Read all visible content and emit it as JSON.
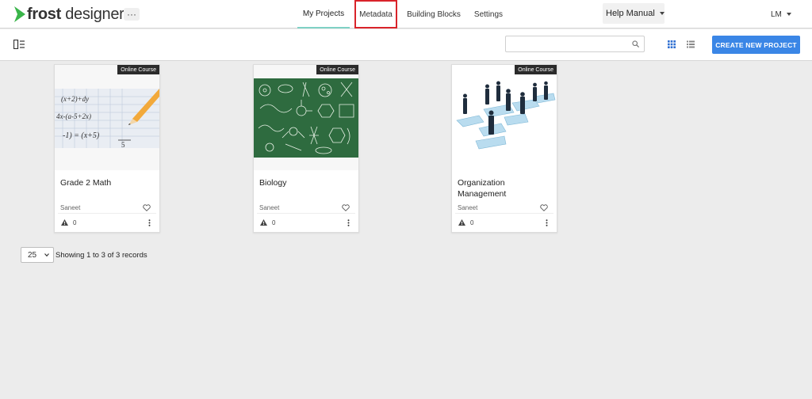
{
  "app": {
    "logo_bold": "frost",
    "logo_light": " designer",
    "more_label": "···"
  },
  "nav": {
    "tabs": [
      {
        "label": "My Projects",
        "active": true
      },
      {
        "label": "Metadata",
        "highlighted": true
      },
      {
        "label": "Building Blocks"
      },
      {
        "label": "Settings"
      }
    ],
    "help_label": "Help Manual",
    "user_initials": "LM"
  },
  "toolbar": {
    "search_placeholder": "",
    "create_label": "CREATE NEW PROJECT",
    "icons": [
      "sidebar-toggle-icon",
      "search-icon",
      "grid-view-icon",
      "list-view-icon"
    ]
  },
  "projects": [
    {
      "title": "Grade 2 Math",
      "badge": "Online Course",
      "author": "Saneet",
      "warnings": "0"
    },
    {
      "title": "Biology",
      "badge": "Online Course",
      "author": "Saneet",
      "warnings": "0"
    },
    {
      "title": "Organization Management",
      "badge": "Online Course",
      "author": "Saneet",
      "warnings": "0"
    }
  ],
  "pagination": {
    "page_size": "25",
    "summary": "Showing 1 to 3 of 3 records"
  },
  "colors": {
    "accent": "#3a86e6",
    "active_tab_underline": "#7fd1c5",
    "highlight_box": "#d9232a",
    "logo_green": "#3ab54a"
  }
}
